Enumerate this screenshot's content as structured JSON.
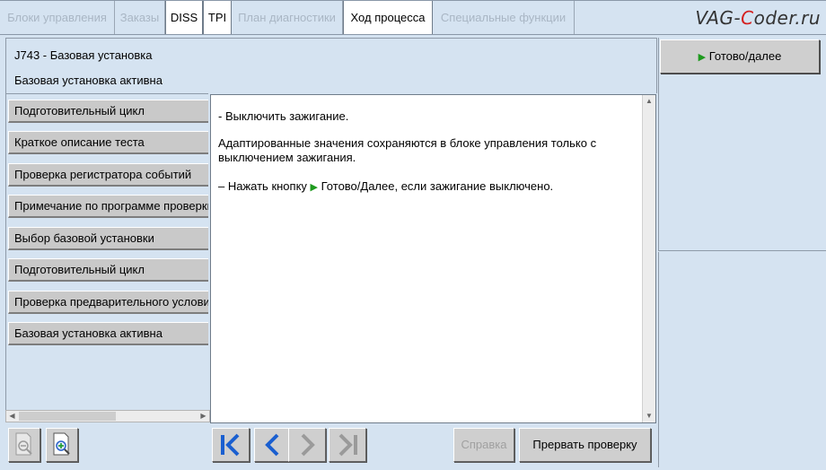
{
  "tabs": [
    {
      "label": "Блоки управления",
      "state": "inactive"
    },
    {
      "label": "Заказы",
      "state": "inactive"
    },
    {
      "label": "DISS",
      "state": "normal"
    },
    {
      "label": "TPI",
      "state": "normal"
    },
    {
      "label": "План диагностики",
      "state": "inactive"
    },
    {
      "label": "Ход процесса",
      "state": "active"
    },
    {
      "label": "Специальные функции",
      "state": "inactive"
    }
  ],
  "logo": {
    "part1": "VAG-",
    "part2": "C",
    "part3": "oder.ru"
  },
  "header": {
    "title": "J743 - Базовая установка",
    "status": "Базовая установка активна"
  },
  "steps": [
    "Подготовительный цикл",
    "Краткое описание теста",
    "Проверка регистратора событий",
    "Примечание по программе проверки",
    "Выбор базовой установки",
    "Подготовительный цикл",
    "Проверка предварительного условия",
    "Базовая установка активна"
  ],
  "content": {
    "line1": "- Выключить зажигание.",
    "line2": "Адаптированные значения сохраняются в блоке управления только с",
    "line3": "выключением зажигания.",
    "line4_prefix": "– Нажать кнопку",
    "line4_suffix": "Готово/Далее, если зажигание выключено."
  },
  "right": {
    "ready_label": "Готово/далее"
  },
  "toolbar": {
    "help_label": "Справка",
    "abort_label": "Прервать проверку"
  },
  "icons": {
    "zoom_out": "zoom-out-icon",
    "zoom_in": "zoom-in-icon",
    "first": "skip-first-icon",
    "back": "back-icon",
    "forward": "forward-icon",
    "last": "skip-last-icon",
    "play": "play-triangle-icon"
  },
  "colors": {
    "accent_blue": "#1a5fd0",
    "play_green": "#1e9a1e",
    "panel_bg": "#d5e3f1"
  }
}
